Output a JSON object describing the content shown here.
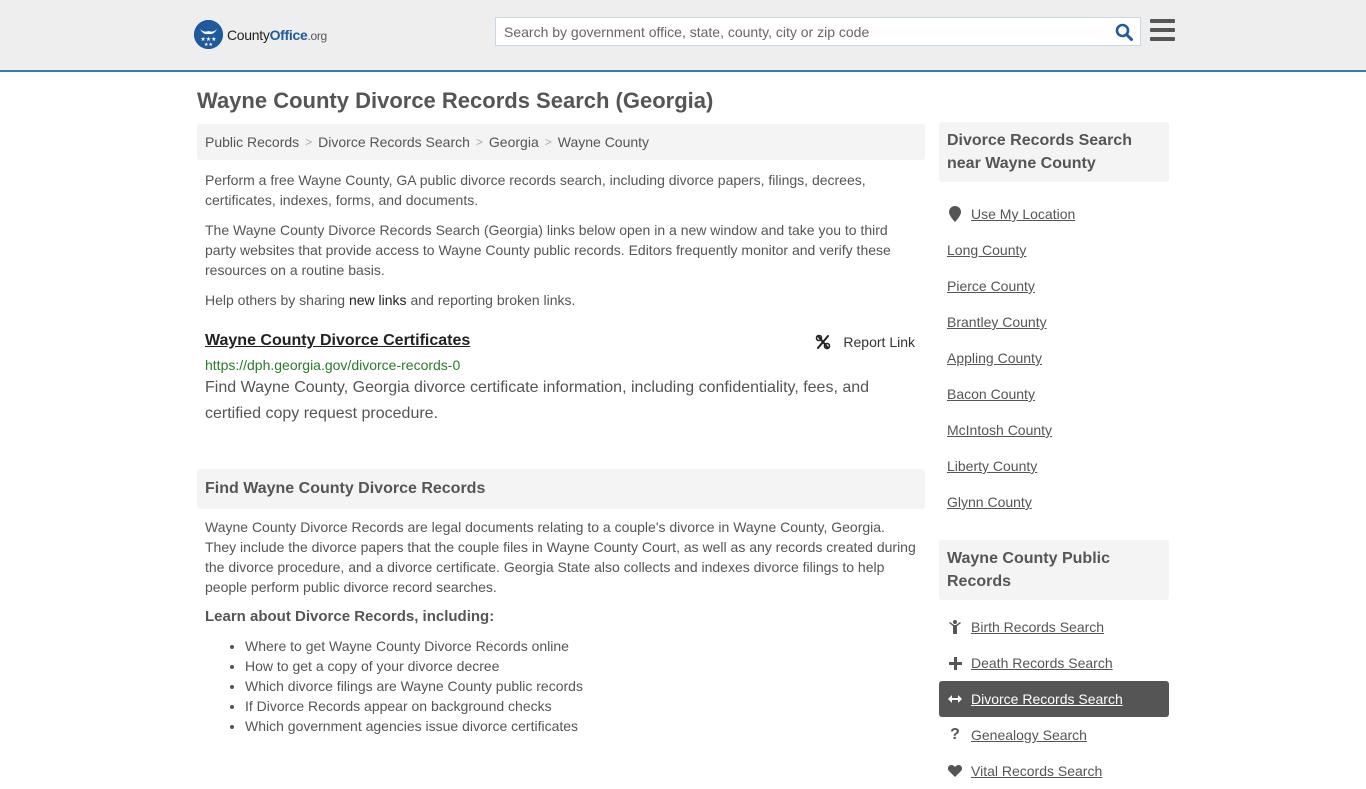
{
  "header": {
    "logo_prefix": "County",
    "logo_brand": "Office",
    "logo_suffix": ".org",
    "search_placeholder": "Search by government office, state, county, city or zip code",
    "accent_color": "#3b7bab"
  },
  "page_title": "Wayne County Divorce Records Search (Georgia)",
  "breadcrumb": [
    {
      "label": "Public Records"
    },
    {
      "label": "Divorce Records Search"
    },
    {
      "label": "Georgia"
    },
    {
      "label": "Wayne County"
    }
  ],
  "intro": {
    "p1": "Perform a free Wayne County, GA public divorce records search, including divorce papers, filings, decrees, certificates, indexes, forms, and documents.",
    "p2": "The Wayne County Divorce Records Search (Georgia) links below open in a new window and take you to third party websites that provide access to Wayne County public records. Editors frequently monitor and verify these resources on a routine basis.",
    "p3_before": "Help others by sharing ",
    "p3_link": "new links",
    "p3_after": " and reporting broken links."
  },
  "links": [
    {
      "title": "Wayne County Divorce Certificates",
      "url": "https://dph.georgia.gov/divorce-records-0",
      "description": "Find Wayne County, Georgia divorce certificate information, including confidentiality, fees, and certified copy request procedure.",
      "report_label": "Report Link"
    }
  ],
  "find_section": {
    "heading": "Find Wayne County Divorce Records",
    "body": "Wayne County Divorce Records are legal documents relating to a couple's divorce in Wayne County, Georgia. They include the divorce papers that the couple files in Wayne County Court, as well as any records created during the divorce procedure, and a divorce certificate. Georgia State also collects and indexes divorce filings to help people perform public divorce record searches.",
    "learn_heading": "Learn about Divorce Records, including:",
    "learn_items": [
      "Where to get Wayne County Divorce Records online",
      "How to get a copy of your divorce decree",
      "Which divorce filings are Wayne County public records",
      "If Divorce Records appear on background checks",
      "Which government agencies issue divorce certificates"
    ]
  },
  "sidebar": {
    "nearby_heading": "Divorce Records Search near Wayne County",
    "use_location": "Use My Location",
    "nearby": [
      "Long County",
      "Pierce County",
      "Brantley County",
      "Appling County",
      "Bacon County",
      "McIntosh County",
      "Liberty County",
      "Glynn County"
    ],
    "records_heading": "Wayne County Public Records",
    "records": [
      {
        "label": "Birth Records Search",
        "icon": "child-icon",
        "glyph": "Ὣ8"
      },
      {
        "label": "Death Records Search",
        "icon": "plus-icon",
        "glyph": "+"
      },
      {
        "label": "Divorce Records Search",
        "icon": "arrows-horizontal-icon",
        "glyph": "↔",
        "active": true
      },
      {
        "label": "Genealogy Search",
        "icon": "question-icon",
        "glyph": "?"
      },
      {
        "label": "Vital Records Search",
        "icon": "heartbeat-icon",
        "glyph": "♥"
      }
    ]
  }
}
